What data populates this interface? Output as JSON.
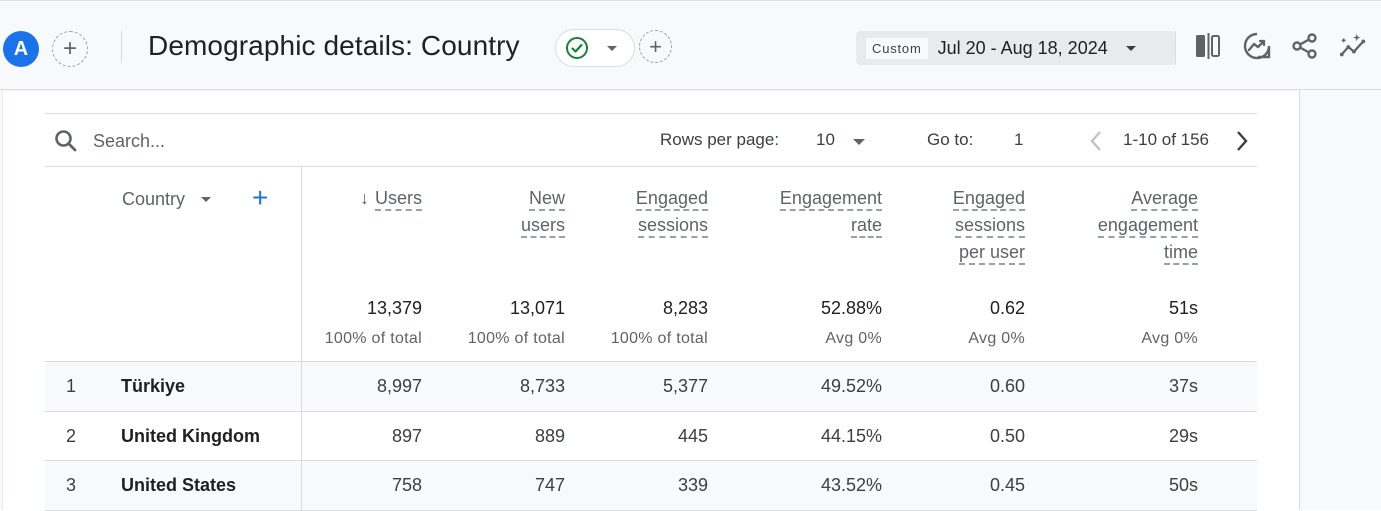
{
  "header": {
    "avatar_letter": "A",
    "title": "Demographic details: Country",
    "date_preset": "Custom",
    "date_range": "Jul 20 - Aug 18, 2024",
    "icons": [
      "compare-icon",
      "insights-icon",
      "share-icon",
      "sparkle-trend-icon"
    ]
  },
  "toolbar": {
    "search_placeholder": "Search...",
    "rows_per_page_label": "Rows per page:",
    "rows_per_page_value": "10",
    "goto_label": "Go to:",
    "goto_value": "1",
    "pagination_text": "1-10 of 156"
  },
  "table": {
    "dimension_label": "Country",
    "columns": [
      {
        "label_lines": [
          "Users"
        ],
        "sorted": true,
        "total": "13,379",
        "sub": "100% of total"
      },
      {
        "label_lines": [
          "New",
          "users"
        ],
        "sorted": false,
        "total": "13,071",
        "sub": "100% of total"
      },
      {
        "label_lines": [
          "Engaged",
          "sessions"
        ],
        "sorted": false,
        "total": "8,283",
        "sub": "100% of total"
      },
      {
        "label_lines": [
          "Engagement",
          "rate"
        ],
        "sorted": false,
        "total": "52.88%",
        "sub": "Avg 0%"
      },
      {
        "label_lines": [
          "Engaged",
          "sessions",
          "per user"
        ],
        "sorted": false,
        "total": "0.62",
        "sub": "Avg 0%"
      },
      {
        "label_lines": [
          "Average",
          "engagement",
          "time"
        ],
        "sorted": false,
        "total": "51s",
        "sub": "Avg 0%"
      }
    ],
    "rows": [
      {
        "rank": "1",
        "country": "Türkiye",
        "values": [
          "8,997",
          "8,733",
          "5,377",
          "49.52%",
          "0.60",
          "37s"
        ]
      },
      {
        "rank": "2",
        "country": "United Kingdom",
        "values": [
          "897",
          "889",
          "445",
          "44.15%",
          "0.50",
          "29s"
        ]
      },
      {
        "rank": "3",
        "country": "United States",
        "values": [
          "758",
          "747",
          "339",
          "43.52%",
          "0.45",
          "50s"
        ]
      }
    ]
  },
  "colors": {
    "accent": "#1a73e8",
    "success": "#188038",
    "header_bg": "#f8f9fa"
  }
}
